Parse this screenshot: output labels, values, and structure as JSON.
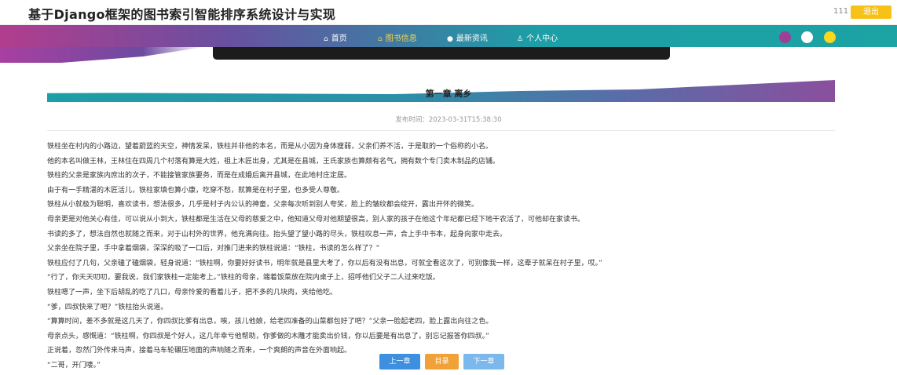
{
  "header": {
    "app_title": "基于Django框架的图书索引智能排序系统设计与实现",
    "user_name": "111",
    "logout_label": "退出"
  },
  "nav": {
    "items": [
      {
        "icon": "home-icon",
        "glyph": "⌂",
        "label": "首页",
        "active": false
      },
      {
        "icon": "book-icon",
        "glyph": "⌂",
        "label": "图书信息",
        "active": true
      },
      {
        "icon": "news-icon",
        "glyph": "●",
        "label": "最新资讯",
        "active": false
      },
      {
        "icon": "user-icon",
        "glyph": "♙",
        "label": "个人中心",
        "active": false
      }
    ],
    "theme_colors": [
      "#9b3f97",
      "#ffffff",
      "#f8d81c"
    ]
  },
  "chapter": {
    "title": "第一章 离乡",
    "publish_time": "发布时间：2023-03-31T15:38:30"
  },
  "paragraphs": [
    "铁柱坐在村内的小路边，望着蔚蓝的天空，神情发呆，铁柱并非他的本名，而是从小因为身体瘦弱，父亲们养不活，于是取的一个俗称的小名。",
    "他的本名叫做王林，王林住在四周几个村落有算是大姓，祖上木匠出身，尤其是在县城，王氏家族也算颇有名气，拥有数个专门卖木制品的店铺。",
    "铁柱的父亲是家族内庶出的次子，不能接管家族要务，而是在成婚后离开县城，在此地村庄定居。",
    "由于有一手精湛的木匠活儿，铁柱家填也算小康，吃穿不愁，就算是在村子里，也多受人尊敬。",
    "铁柱从小就极为聪明，喜欢读书，想法很多，几乎是村子内公认的神童，父亲每次听到别人夸奖，脸上的皱纹都会绽开，露出开怀的微笑。",
    "母亲更是对他关心有佳，可以说从小到大，铁柱都是生活在父母的慈爱之中，他知道父母对他期望很高，别人家的孩子在他这个年纪都已经下地干农活了，可他却在家读书。",
    "书读的多了，想法自然也就随之而来，对于山村外的世界，他充满向往。抬头望了望小路的尽头，铁柱叹息一声，合上手中书本，起身向家中走去。",
    "父亲坐在院子里，手中拿着烟袋，深深的吸了一口后，对推门进来的铁柱说道：“铁柱，书读的怎么样了？”",
    "铁柱应付了几句，父亲磕了磕烟袋，轻身说道：“铁柱啊，你要好好读书，明年就是县里大考了，你以后有没有出息，可就全看这次了，可别像我一样，这辈子就呆在村子里，哎。”",
    "“行了，你天天叨叨，要我说，我们家铁柱一定能考上。”铁柱的母亲，端着饭菜放在院内桌子上，招呼他们父子二人过来吃饭。",
    "铁柱嗯了一声，坐下后胡乱的吃了几口，母亲怜爱的看着儿子，把不多的几块肉，夹给他吃。",
    "“爹，四叔快来了吧？”铁柱抬头说道。",
    "“算算时间，差不多就是这几天了，你四叔比爹有出息，唉，孩儿他娘，给老四准备的山菜都包好了吧？”父亲一脸起老四，脸上露出向往之色。",
    "母亲点头，感慨道：“铁柱啊，你四叔是个好人，这几年幸亏他帮助，你爹做的木雕才能卖出价钱，你以后要是有出息了，别忘记报答你四叔。”",
    "正说着，忽然门外传来马声，接着马车轮碾压地面的声响随之而来，一个爽朗的声音在外面响起。",
    "“二哥，开门喽。”"
  ],
  "pager": {
    "prev_label": "上一章",
    "catalog_label": "目录",
    "next_label": "下一章"
  }
}
